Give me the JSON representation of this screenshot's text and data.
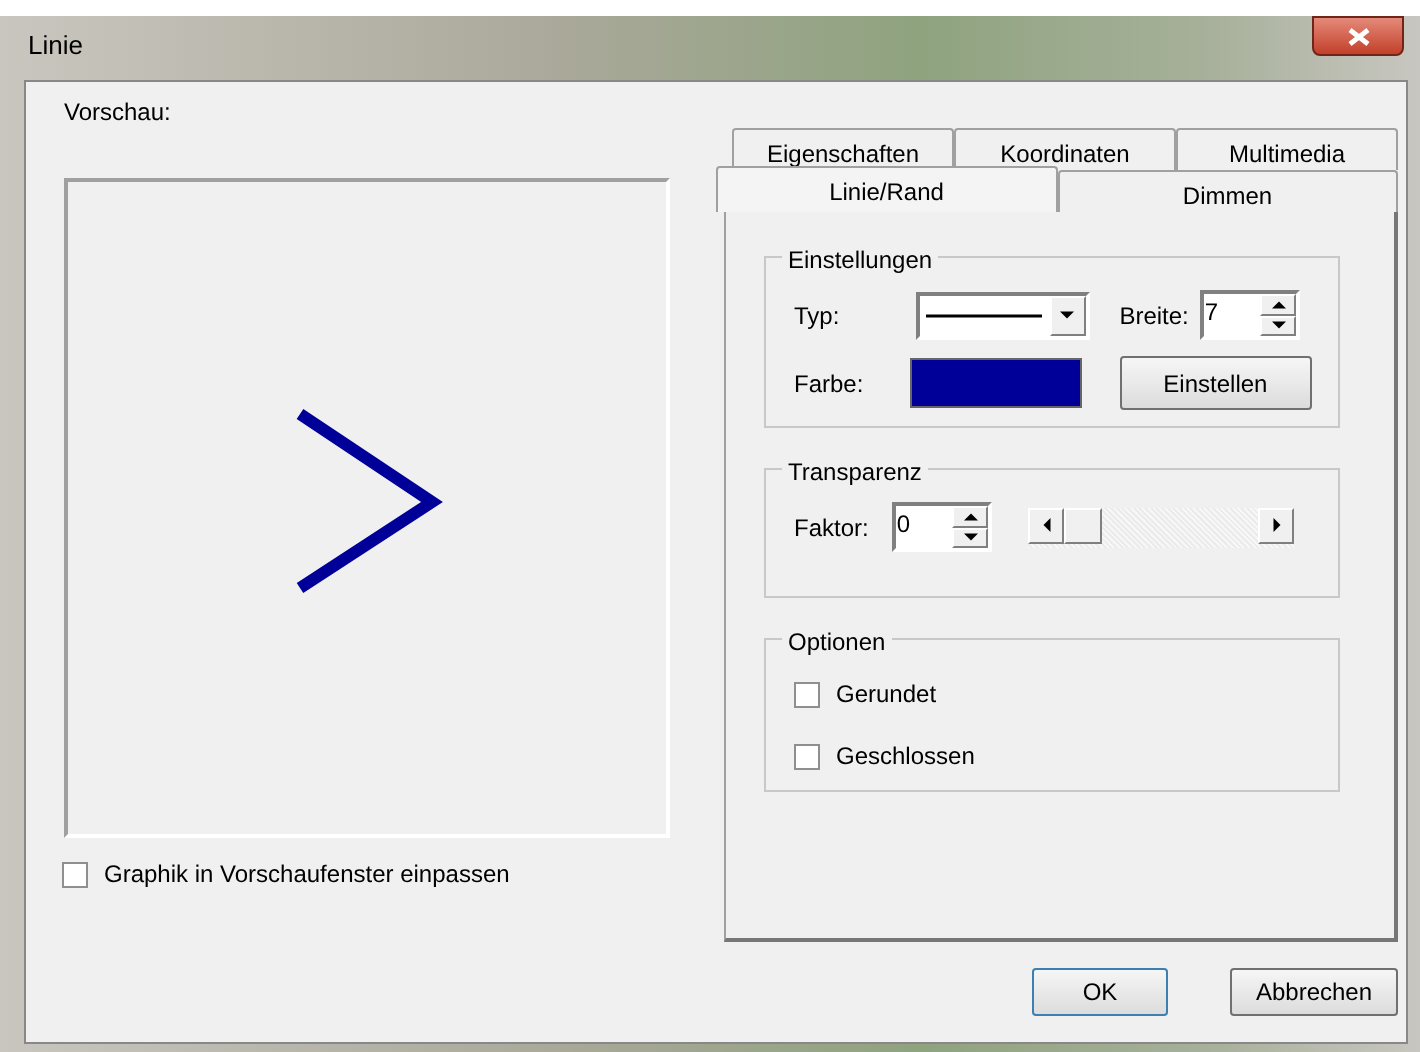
{
  "window": {
    "title": "Linie"
  },
  "preview": {
    "label": "Vorschau:"
  },
  "fit_checkbox": {
    "label": "Graphik in Vorschaufenster einpassen",
    "checked": false
  },
  "tab_rows": [
    [
      {
        "label": "Eigenschaften",
        "selected": false
      },
      {
        "label": "Koordinaten",
        "selected": false
      },
      {
        "label": "Multimedia",
        "selected": false
      }
    ],
    [
      {
        "label": "Linie/Rand",
        "selected": true
      },
      {
        "label": "Dimmen",
        "selected": false
      }
    ]
  ],
  "einstellungen": {
    "title": "Einstellungen",
    "type_label": "Typ:",
    "width_label": "Breite:",
    "width_value": "7",
    "color_label": "Farbe:",
    "color": "#000099",
    "set_button": "Einstellen"
  },
  "transparenz": {
    "title": "Transparenz",
    "factor_label": "Faktor:",
    "factor_value": "0",
    "level": 0
  },
  "optionen": {
    "title": "Optionen",
    "items": [
      {
        "label": "Gerundet",
        "checked": false
      },
      {
        "label": "Geschlossen",
        "checked": false
      }
    ]
  },
  "buttons": [
    "OK",
    "Abbrechen"
  ]
}
